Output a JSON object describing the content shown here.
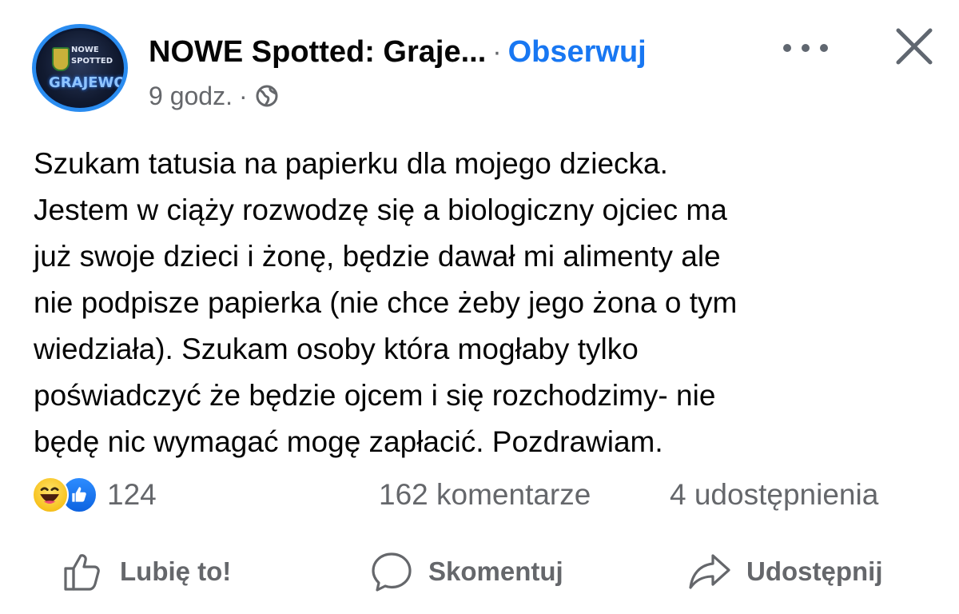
{
  "header": {
    "page_name": "NOWE Spotted: Graje...",
    "separator": "·",
    "follow_label": "Obserwuj",
    "time": "9 godz.",
    "time_separator": "·",
    "avatar_text": [
      "NOWE",
      "SPOTTED",
      "GRAJEWO"
    ]
  },
  "post": {
    "lines": [
      "Szukam tatusia na papierku dla mojego dziecka.",
      "Jestem w ciąży rozwodzę się a biologiczny ojciec ma",
      "już swoje dzieci i żonę, będzie dawał mi alimenty ale",
      "nie podpisze papierka (nie chce żeby jego żona o tym",
      "wiedziała). Szukam osoby która mogłaby tylko",
      "poświadczyć że będzie ojcem i się rozchodzimy- nie",
      "będę nic wymagać mogę zapłacić. Pozdrawiam."
    ]
  },
  "stats": {
    "reaction_count": "124",
    "comments": "162 komentarze",
    "shares": "4 udostępnienia"
  },
  "actions": {
    "like": "Lubię to!",
    "comment": "Skomentuj",
    "share": "Udostępnij"
  },
  "icons": {
    "more": "more-options-icon",
    "close": "close-icon",
    "privacy": "globe-icon",
    "reaction_haha": "haha-reaction-icon",
    "reaction_like": "like-reaction-icon"
  },
  "colors": {
    "accent": "#1877f2",
    "secondary_text": "#65676b",
    "primary_text": "#050505"
  }
}
